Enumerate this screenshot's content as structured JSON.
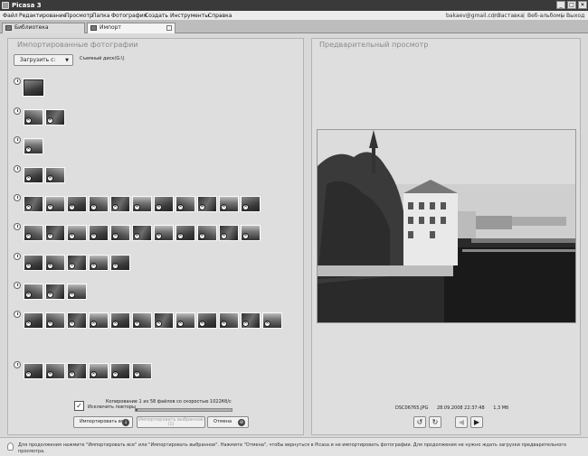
{
  "window": {
    "title": "Picasa 3",
    "buttons": [
      "_",
      "□",
      "✕"
    ]
  },
  "menu": {
    "items": [
      "Файл",
      "Редактирование",
      "Просмотр",
      "Папка",
      "Фотография",
      "Создать",
      "Инструменты",
      "Справка"
    ],
    "email": "bakaev@gmail.com",
    "links": [
      "Заставка",
      "Веб-альбомы",
      "Выход"
    ],
    "separator": "|"
  },
  "tabs": {
    "library": "Библиотека",
    "import": "Импорт"
  },
  "import_panel": {
    "title": "Импортированные фотографии",
    "dropdown_label": "Загрузить с:",
    "source": "Съемный диск(G:\\)",
    "exclude_duplicates_label": "Исключить повторы",
    "exclude_duplicates_checked": true,
    "copy_status": "Копирование 1 из 58 файлов со скоростью 1022Кб/с",
    "progress_fraction": 0.02,
    "buttons": {
      "import_all": "Импортировать все",
      "import_selected": "Импортировать выбранное (1)",
      "cancel": "Отмена"
    }
  },
  "preview_panel": {
    "title": "Предварительный просмотр",
    "filename": "DSC06765.JPG",
    "datetime": "28.09.2008 22:37:48",
    "filesize": "1,3 Мб",
    "buttons": {
      "rotate_left": "↺",
      "rotate_right": "↻",
      "prev": "◀",
      "next": "▶"
    }
  },
  "status_tip": "Для продолжения нажмите \"Импортировать все\" или \"Импортировать выбранное\". Нажмите \"Отмена\", чтобы вернуться в Picasa и не импортировать фотографии. Для продолжения не нужно ждать загрузки предварительного просмотра.",
  "thumbnail_groups": [
    {
      "count": 1
    },
    {
      "count": 2
    },
    {
      "count": 1
    },
    {
      "count": 2
    },
    {
      "count": 11
    },
    {
      "count": 11
    },
    {
      "count": 5
    },
    {
      "count": 3
    },
    {
      "count": 12
    },
    {
      "count": 6
    }
  ],
  "icons": [
    "picasa-app-icon",
    "library-tab-icon",
    "import-tab-icon",
    "clock-icon",
    "exclude-mark-icon",
    "rotate-left-icon",
    "rotate-right-icon",
    "prev-arrow-icon",
    "next-arrow-icon",
    "lightbulb-icon"
  ]
}
